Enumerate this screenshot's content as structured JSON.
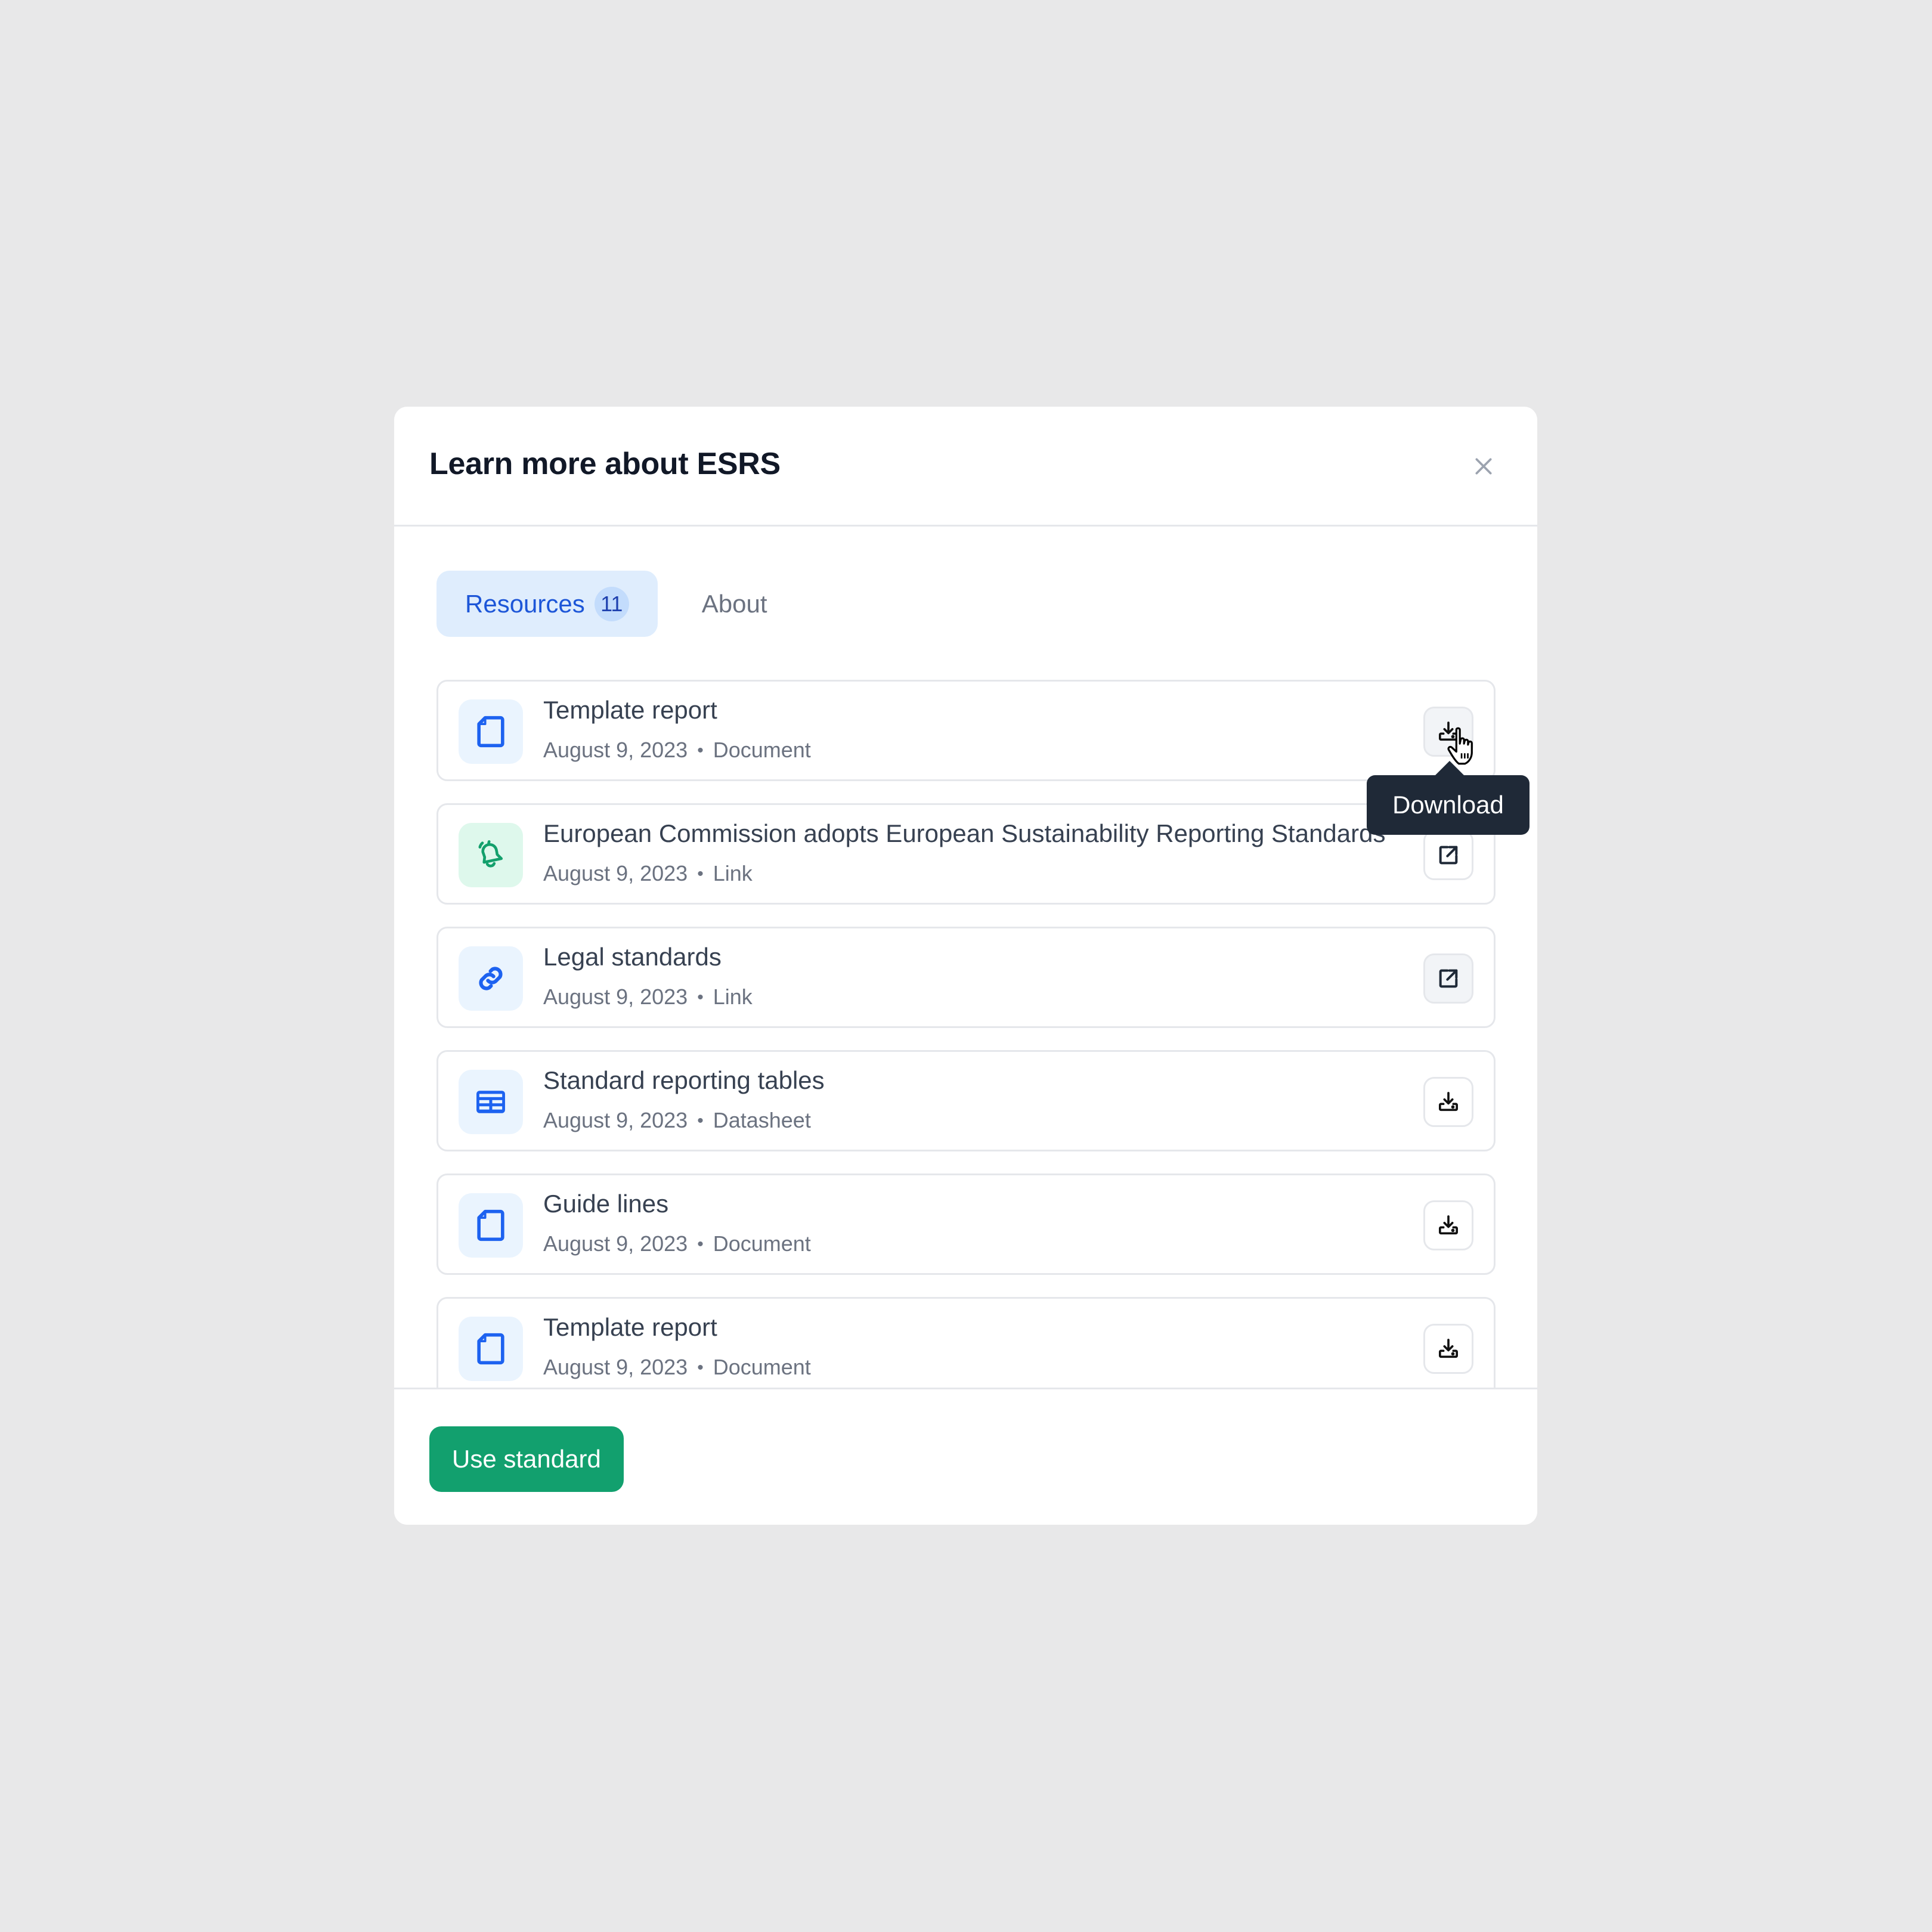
{
  "modal": {
    "title": "Learn more about ESRS",
    "close_icon": "close-icon"
  },
  "tabs": [
    {
      "label": "Resources",
      "count": "11",
      "active": true
    },
    {
      "label": "About",
      "active": false
    }
  ],
  "resources": [
    {
      "title": "Template report",
      "date": "August 9, 2023",
      "type": "Document",
      "icon": "document-icon",
      "action": "download",
      "action_icon": "download-icon"
    },
    {
      "title": "European Commission adopts European Sustainability Reporting Standards",
      "date": "August 9, 2023",
      "type": "Link",
      "icon": "bell-icon",
      "action": "open-link",
      "action_icon": "external-link-icon"
    },
    {
      "title": "Legal standards",
      "date": "August 9, 2023",
      "type": "Link",
      "icon": "link-icon",
      "action": "open-link",
      "action_icon": "external-link-icon"
    },
    {
      "title": "Standard reporting tables",
      "date": "August 9, 2023",
      "type": "Datasheet",
      "icon": "table-icon",
      "action": "download",
      "action_icon": "download-icon"
    },
    {
      "title": "Guide lines",
      "date": "August 9, 2023",
      "type": "Document",
      "icon": "document-icon",
      "action": "download",
      "action_icon": "download-icon"
    },
    {
      "title": "Template report",
      "date": "August 9, 2023",
      "type": "Document",
      "icon": "document-icon",
      "action": "download",
      "action_icon": "download-icon"
    }
  ],
  "meta_separator": "•",
  "tooltip": {
    "text": "Download"
  },
  "footer": {
    "primary_label": "Use standard"
  },
  "colors": {
    "accent_blue": "#1d56d8",
    "primary_green": "#12a06e",
    "tooltip_bg": "#1f2937",
    "backdrop": "#e8e8e9"
  }
}
